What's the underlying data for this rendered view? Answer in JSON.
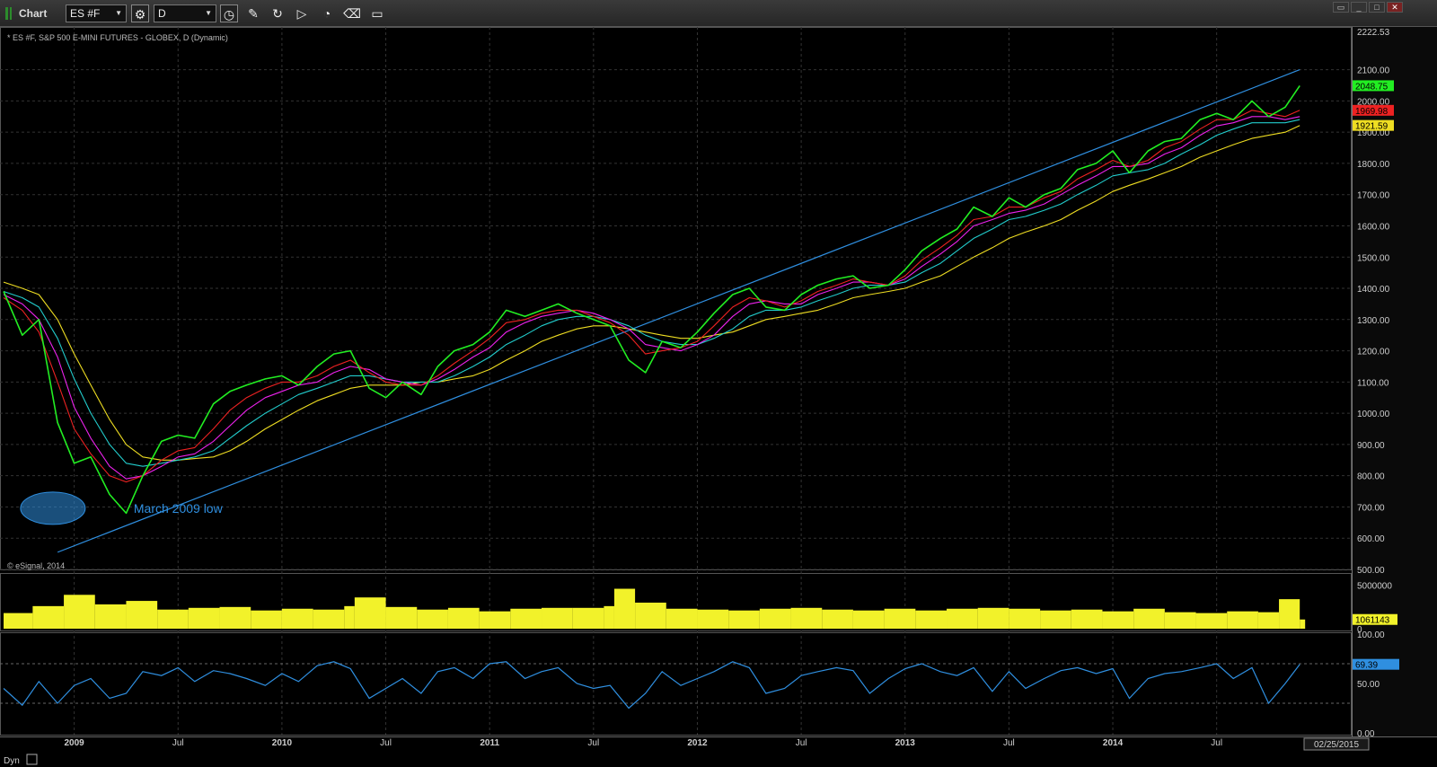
{
  "window": {
    "title": "Chart",
    "symbol": "ES #F",
    "interval": "D"
  },
  "toolbar": {
    "icons": [
      "settings-gear-icon",
      "interval-clock-icon",
      "pencil-draw-icon",
      "refresh-icon",
      "play-icon",
      "alert-icon",
      "eraser-icon",
      "comment-icon"
    ]
  },
  "chart_header": "* ES #F, S&P 500 E-MINI FUTURES - GLOBEX, D (Dynamic)",
  "copyright": "© eSignal, 2014",
  "colors": {
    "background": "#000000",
    "price": "#22ee22",
    "ma_red": "#ee2222",
    "ma_magenta": "#ee22ee",
    "ma_cyan": "#22cccc",
    "ma_yellow": "#eedd22",
    "trendline": "#2f8fe0",
    "volume": "#f2f22a",
    "rsi": "#2f8fe0"
  },
  "chart_data": [
    {
      "type": "line",
      "panel": "price",
      "ylim": [
        500,
        2222.53
      ],
      "price_scale_ticks": [
        "2222.53",
        "2100.00",
        "2000.00",
        "1900.00",
        "1800.00",
        "1700.00",
        "1600.00",
        "1500.00",
        "1400.00",
        "1300.00",
        "1200.00",
        "1100.00",
        "1000.00",
        "900.00",
        "800.00",
        "700.00",
        "600.00",
        "500.00"
      ],
      "price_scale_tick_values": [
        2222.53,
        2100,
        2000,
        1900,
        1800,
        1700,
        1600,
        1500,
        1400,
        1300,
        1200,
        1100,
        1000,
        900,
        800,
        700,
        600,
        500
      ],
      "x": [
        2008.66,
        2008.75,
        2008.83,
        2008.92,
        2009.0,
        2009.08,
        2009.17,
        2009.25,
        2009.33,
        2009.42,
        2009.5,
        2009.58,
        2009.67,
        2009.75,
        2009.83,
        2009.92,
        2010.0,
        2010.08,
        2010.17,
        2010.25,
        2010.33,
        2010.42,
        2010.5,
        2010.58,
        2010.67,
        2010.75,
        2010.83,
        2010.92,
        2011.0,
        2011.08,
        2011.17,
        2011.25,
        2011.33,
        2011.42,
        2011.5,
        2011.58,
        2011.67,
        2011.75,
        2011.83,
        2011.92,
        2012.0,
        2012.08,
        2012.17,
        2012.25,
        2012.33,
        2012.42,
        2012.5,
        2012.58,
        2012.67,
        2012.75,
        2012.83,
        2012.92,
        2013.0,
        2013.08,
        2013.17,
        2013.25,
        2013.33,
        2013.42,
        2013.5,
        2013.58,
        2013.67,
        2013.75,
        2013.83,
        2013.92,
        2014.0,
        2014.08,
        2014.17,
        2014.25,
        2014.33,
        2014.42,
        2014.5,
        2014.58,
        2014.67,
        2014.75,
        2014.83,
        2014.9
      ],
      "series": [
        {
          "values": [
            1390,
            1250,
            1300,
            970,
            840,
            860,
            740,
            680,
            800,
            910,
            930,
            920,
            1030,
            1070,
            1090,
            1110,
            1120,
            1090,
            1150,
            1190,
            1200,
            1080,
            1050,
            1100,
            1060,
            1150,
            1200,
            1220,
            1260,
            1330,
            1310,
            1330,
            1350,
            1320,
            1300,
            1280,
            1170,
            1130,
            1230,
            1210,
            1260,
            1320,
            1380,
            1400,
            1340,
            1330,
            1380,
            1410,
            1430,
            1440,
            1400,
            1410,
            1460,
            1520,
            1560,
            1590,
            1660,
            1630,
            1690,
            1660,
            1700,
            1720,
            1780,
            1800,
            1840,
            1770,
            1840,
            1870,
            1880,
            1940,
            1960,
            1940,
            2000,
            1950,
            1980,
            2048.75
          ]
        },
        {
          "values": [
            1370,
            1330,
            1260,
            1100,
            950,
            870,
            800,
            780,
            800,
            850,
            880,
            890,
            950,
            1010,
            1050,
            1080,
            1100,
            1100,
            1120,
            1150,
            1170,
            1130,
            1100,
            1090,
            1090,
            1120,
            1160,
            1200,
            1240,
            1290,
            1300,
            1320,
            1330,
            1330,
            1310,
            1290,
            1250,
            1190,
            1200,
            1210,
            1230,
            1280,
            1340,
            1370,
            1360,
            1340,
            1360,
            1390,
            1410,
            1430,
            1420,
            1410,
            1440,
            1490,
            1530,
            1570,
            1620,
            1630,
            1660,
            1660,
            1690,
            1710,
            1750,
            1780,
            1810,
            1790,
            1810,
            1850,
            1870,
            1910,
            1940,
            1940,
            1970,
            1960,
            1950,
            1969.98
          ]
        },
        {
          "values": [
            1380,
            1350,
            1300,
            1180,
            1020,
            920,
            830,
            790,
            800,
            830,
            860,
            870,
            910,
            960,
            1010,
            1050,
            1070,
            1090,
            1100,
            1130,
            1150,
            1140,
            1110,
            1100,
            1090,
            1110,
            1140,
            1180,
            1210,
            1260,
            1290,
            1310,
            1320,
            1330,
            1320,
            1300,
            1270,
            1220,
            1210,
            1200,
            1220,
            1250,
            1310,
            1350,
            1360,
            1350,
            1350,
            1380,
            1400,
            1420,
            1420,
            1410,
            1430,
            1470,
            1510,
            1550,
            1600,
            1620,
            1640,
            1650,
            1670,
            1700,
            1730,
            1760,
            1790,
            1790,
            1800,
            1830,
            1850,
            1890,
            1920,
            1930,
            1950,
            1950,
            1940,
            1950
          ]
        },
        {
          "values": [
            1390,
            1370,
            1340,
            1240,
            1110,
            1000,
            900,
            840,
            830,
            840,
            850,
            860,
            880,
            920,
            960,
            1000,
            1030,
            1060,
            1080,
            1100,
            1120,
            1120,
            1110,
            1100,
            1100,
            1100,
            1120,
            1150,
            1180,
            1220,
            1250,
            1280,
            1300,
            1310,
            1310,
            1300,
            1280,
            1250,
            1230,
            1220,
            1220,
            1240,
            1270,
            1310,
            1330,
            1330,
            1340,
            1360,
            1380,
            1400,
            1410,
            1410,
            1420,
            1450,
            1480,
            1520,
            1560,
            1590,
            1620,
            1630,
            1650,
            1670,
            1700,
            1730,
            1760,
            1770,
            1780,
            1800,
            1830,
            1860,
            1890,
            1910,
            1930,
            1930,
            1930,
            1940
          ]
        },
        {
          "values": [
            1420,
            1400,
            1380,
            1300,
            1190,
            1090,
            980,
            900,
            860,
            850,
            850,
            855,
            860,
            880,
            910,
            950,
            980,
            1010,
            1040,
            1060,
            1080,
            1090,
            1090,
            1090,
            1100,
            1100,
            1110,
            1120,
            1140,
            1170,
            1200,
            1230,
            1250,
            1270,
            1280,
            1280,
            1270,
            1260,
            1250,
            1240,
            1240,
            1250,
            1260,
            1280,
            1300,
            1310,
            1320,
            1330,
            1350,
            1370,
            1380,
            1390,
            1400,
            1420,
            1440,
            1470,
            1500,
            1530,
            1560,
            1580,
            1600,
            1620,
            1650,
            1680,
            1710,
            1730,
            1750,
            1770,
            1790,
            1820,
            1840,
            1860,
            1880,
            1890,
            1900,
            1921.59
          ]
        }
      ],
      "price_labels": [
        {
          "text": "2048.75",
          "value": 2048.75,
          "color": "#22ee22"
        },
        {
          "text": "1969.98",
          "value": 1969.98,
          "color": "#ee2222"
        },
        {
          "text": "1921.59",
          "value": 1921.59,
          "color": "#eedd22"
        }
      ],
      "trendline": {
        "x": [
          2008.92,
          2014.9
        ],
        "y": [
          555,
          2100
        ]
      },
      "annotation": {
        "text": "March 2009 low",
        "x": 2009.2,
        "y": 690
      }
    },
    {
      "type": "bar",
      "panel": "volume",
      "ylim": [
        0,
        6000000
      ],
      "ticks": [
        "5000000",
        "0"
      ],
      "tick_values": [
        5000000,
        0
      ],
      "last_label": "1061143",
      "last_value": 1061143,
      "x": [
        2008.66,
        2008.8,
        2008.95,
        2009.1,
        2009.25,
        2009.4,
        2009.55,
        2009.7,
        2009.85,
        2010.0,
        2010.15,
        2010.3,
        2010.35,
        2010.5,
        2010.65,
        2010.8,
        2010.95,
        2011.1,
        2011.25,
        2011.4,
        2011.55,
        2011.6,
        2011.7,
        2011.85,
        2012.0,
        2012.15,
        2012.3,
        2012.45,
        2012.6,
        2012.75,
        2012.9,
        2013.05,
        2013.2,
        2013.35,
        2013.5,
        2013.65,
        2013.8,
        2013.95,
        2014.1,
        2014.25,
        2014.4,
        2014.55,
        2014.7,
        2014.8,
        2014.9
      ],
      "values": [
        1800000,
        2600000,
        3900000,
        2800000,
        3200000,
        2200000,
        2400000,
        2500000,
        2100000,
        2300000,
        2200000,
        2600000,
        3600000,
        2500000,
        2200000,
        2400000,
        2000000,
        2300000,
        2400000,
        2400000,
        2600000,
        4600000,
        3000000,
        2300000,
        2200000,
        2100000,
        2300000,
        2400000,
        2200000,
        2100000,
        2300000,
        2100000,
        2300000,
        2400000,
        2300000,
        2100000,
        2200000,
        2000000,
        2300000,
        1900000,
        1800000,
        2000000,
        1900000,
        3400000,
        1061143
      ]
    },
    {
      "type": "line",
      "panel": "rsi",
      "ylim": [
        0,
        100
      ],
      "ticks": [
        "100.00",
        "50.00",
        "0.00"
      ],
      "tick_values": [
        100,
        50,
        0
      ],
      "levels": [
        70,
        30
      ],
      "last_label": "69.39",
      "last_value": 69.39,
      "x": [
        2008.66,
        2008.75,
        2008.83,
        2008.92,
        2009.0,
        2009.08,
        2009.17,
        2009.25,
        2009.33,
        2009.42,
        2009.5,
        2009.58,
        2009.67,
        2009.75,
        2009.83,
        2009.92,
        2010.0,
        2010.08,
        2010.17,
        2010.25,
        2010.33,
        2010.42,
        2010.5,
        2010.58,
        2010.67,
        2010.75,
        2010.83,
        2010.92,
        2011.0,
        2011.08,
        2011.17,
        2011.25,
        2011.33,
        2011.42,
        2011.5,
        2011.58,
        2011.67,
        2011.75,
        2011.83,
        2011.92,
        2012.0,
        2012.08,
        2012.17,
        2012.25,
        2012.33,
        2012.42,
        2012.5,
        2012.58,
        2012.67,
        2012.75,
        2012.83,
        2012.92,
        2013.0,
        2013.08,
        2013.17,
        2013.25,
        2013.33,
        2013.42,
        2013.5,
        2013.58,
        2013.67,
        2013.75,
        2013.83,
        2013.92,
        2014.0,
        2014.08,
        2014.17,
        2014.25,
        2014.33,
        2014.42,
        2014.5,
        2014.58,
        2014.67,
        2014.75,
        2014.83,
        2014.9
      ],
      "values": [
        45,
        28,
        52,
        30,
        48,
        55,
        35,
        40,
        62,
        58,
        66,
        52,
        63,
        60,
        55,
        48,
        60,
        52,
        68,
        72,
        65,
        35,
        45,
        55,
        40,
        62,
        66,
        55,
        70,
        72,
        55,
        62,
        66,
        50,
        45,
        48,
        25,
        40,
        62,
        48,
        55,
        62,
        72,
        66,
        40,
        45,
        58,
        62,
        66,
        63,
        40,
        55,
        65,
        70,
        62,
        58,
        66,
        42,
        62,
        45,
        55,
        63,
        66,
        60,
        65,
        35,
        55,
        60,
        62,
        66,
        70,
        55,
        66,
        30,
        50,
        69.39
      ]
    }
  ],
  "x_axis": {
    "labels": [
      {
        "text": "2009",
        "x": 2009.0,
        "bold": true
      },
      {
        "text": "Jul",
        "x": 2009.5,
        "bold": false
      },
      {
        "text": "2010",
        "x": 2010.0,
        "bold": true
      },
      {
        "text": "Jul",
        "x": 2010.5,
        "bold": false
      },
      {
        "text": "2011",
        "x": 2011.0,
        "bold": true
      },
      {
        "text": "Jul",
        "x": 2011.5,
        "bold": false
      },
      {
        "text": "2012",
        "x": 2012.0,
        "bold": true
      },
      {
        "text": "Jul",
        "x": 2012.5,
        "bold": false
      },
      {
        "text": "2013",
        "x": 2013.0,
        "bold": true
      },
      {
        "text": "Jul",
        "x": 2013.5,
        "bold": false
      },
      {
        "text": "2014",
        "x": 2014.0,
        "bold": true
      },
      {
        "text": "Jul",
        "x": 2014.5,
        "bold": false
      }
    ],
    "range": [
      2008.66,
      2015.15
    ],
    "end_date": "02/25/2015"
  },
  "footer": {
    "mode": "Dyn"
  }
}
